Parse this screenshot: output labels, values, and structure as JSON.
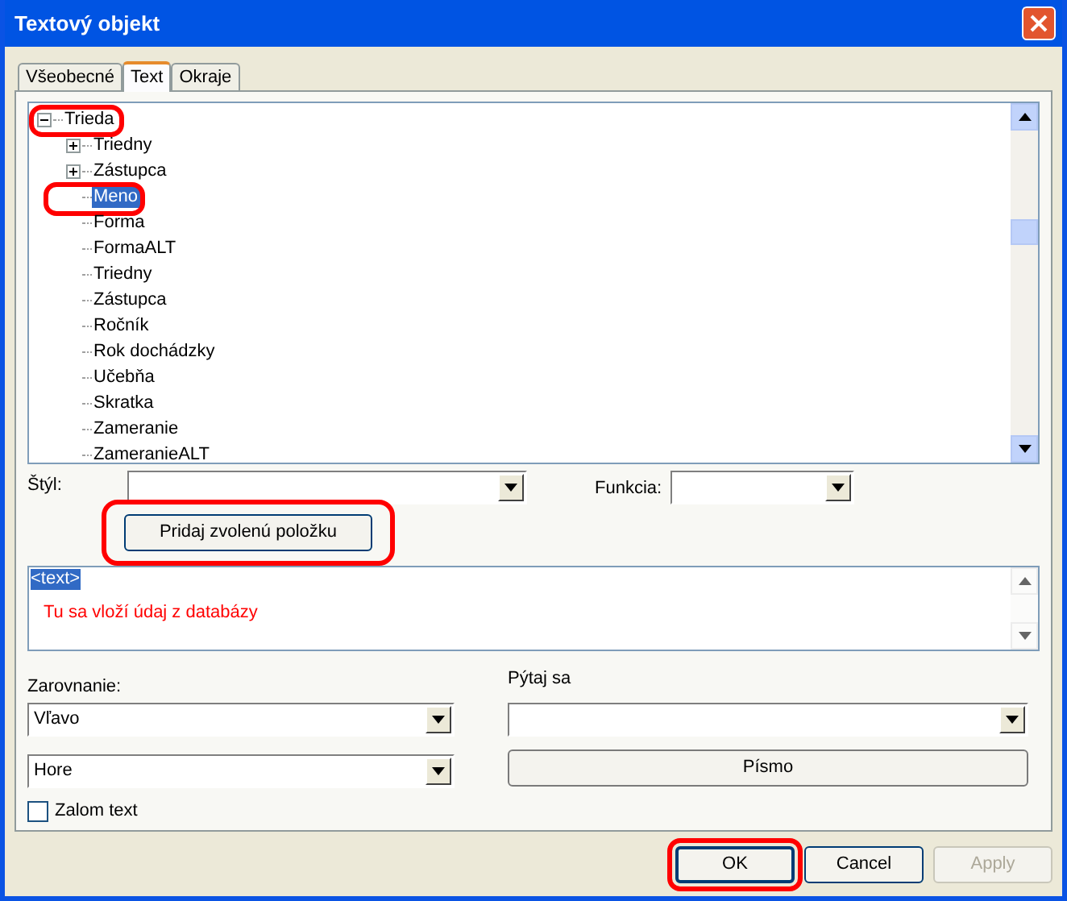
{
  "window": {
    "title": "Textový objekt"
  },
  "tabs": [
    {
      "label": "Všeobecné",
      "selected": false
    },
    {
      "label": "Text",
      "selected": true
    },
    {
      "label": "Okraje",
      "selected": false
    }
  ],
  "tree": [
    {
      "label": "Trieda",
      "expanded": true,
      "selected": false,
      "highlighted": true,
      "children": [
        {
          "label": "Triedny",
          "expanded": false,
          "selected": false,
          "highlighted": false
        },
        {
          "label": "Zástupca",
          "expanded": false,
          "selected": false,
          "highlighted": false
        },
        {
          "label": "Meno",
          "selected": true,
          "highlighted": true
        },
        {
          "label": "Forma",
          "selected": false,
          "highlighted": false
        },
        {
          "label": "FormaALT",
          "selected": false,
          "highlighted": false
        },
        {
          "label": "Triedny",
          "selected": false,
          "highlighted": false
        },
        {
          "label": "Zástupca",
          "selected": false,
          "highlighted": false
        },
        {
          "label": "Ročník",
          "selected": false,
          "highlighted": false
        },
        {
          "label": "Rok dochádzky",
          "selected": false,
          "highlighted": false
        },
        {
          "label": "Učebňa",
          "selected": false,
          "highlighted": false
        },
        {
          "label": "Skratka",
          "selected": false,
          "highlighted": false
        },
        {
          "label": "Zameranie",
          "selected": false,
          "highlighted": false
        },
        {
          "label": "ZameranieALT",
          "selected": false,
          "highlighted": false
        }
      ]
    }
  ],
  "style_label": "Štýl:",
  "function_label": "Funkcia:",
  "add_button": {
    "label": "Pridaj zvolenú položku",
    "highlighted": true
  },
  "editor_lines": [
    {
      "text": "<text>",
      "kind": "tag",
      "selected": true
    },
    {
      "text": "Tu sa vloží údaj z databázy",
      "kind": "hint",
      "selected": false
    }
  ],
  "alignment_label": "Zarovnanie:",
  "horizontal": "Vľavo",
  "vertical": "Hore",
  "ask_label": "Pýtaj sa",
  "font_button": "Písmo",
  "wrap": {
    "label": "Zalom text",
    "checked": false
  },
  "buttons": [
    {
      "label": "OK",
      "default": true,
      "disabled": false,
      "highlighted": true
    },
    {
      "label": "Cancel",
      "default": false,
      "disabled": false,
      "highlighted": false
    },
    {
      "label": "Apply",
      "default": false,
      "disabled": true,
      "highlighted": false
    }
  ]
}
